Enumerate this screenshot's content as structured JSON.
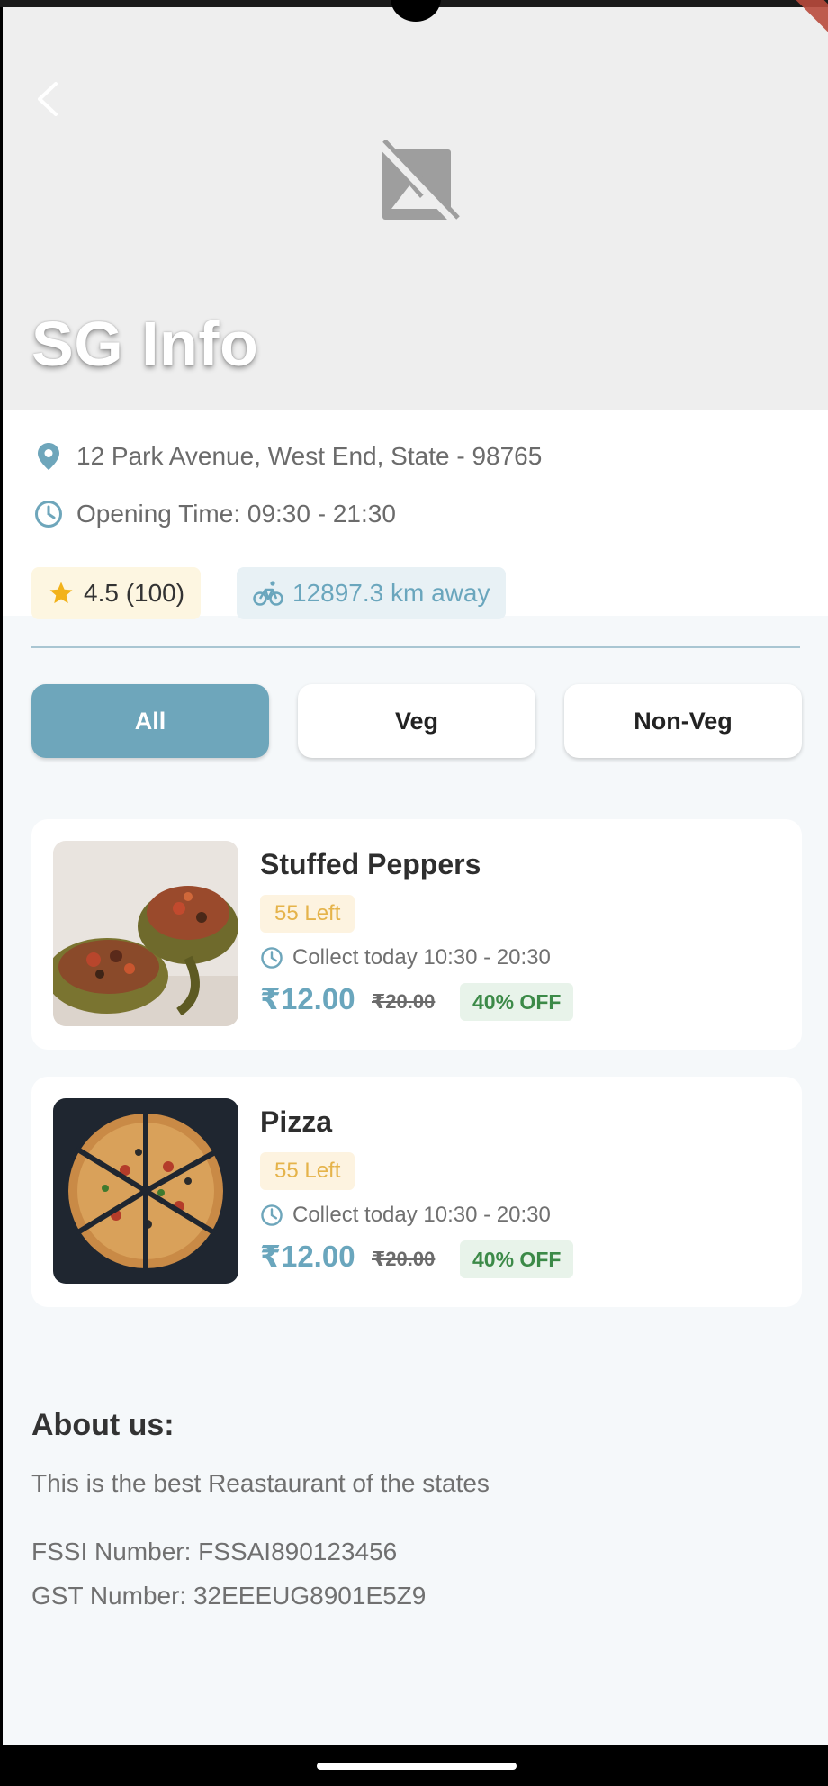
{
  "hero": {
    "title": "SG Info"
  },
  "info": {
    "address": "12 Park Avenue, West End, State - 98765",
    "opening_time": "Opening Time: 09:30 - 21:30",
    "rating": "4.5 (100)",
    "distance": "12897.3 km away"
  },
  "filters": {
    "all": "All",
    "veg": "Veg",
    "nonveg": "Non-Veg",
    "selected": "All"
  },
  "items": [
    {
      "name": "Stuffed Peppers",
      "left": "55 Left",
      "collect": "Collect today 10:30 - 20:30",
      "price": "₹12.00",
      "old_price": "₹20.00",
      "discount": "40% OFF"
    },
    {
      "name": "Pizza",
      "left": "55 Left",
      "collect": "Collect today 10:30 - 20:30",
      "price": "₹12.00",
      "old_price": "₹20.00",
      "discount": "40% OFF"
    }
  ],
  "about": {
    "title": "About us:",
    "text": "This is the best Reastaurant of the states",
    "fssi": "FSSI Number: FSSAI890123456",
    "gst": "GST Number: 32EEEUG8901E5Z9"
  },
  "colors": {
    "accent": "#6ea6bb",
    "rating_bg": "#fdf6e1",
    "star": "#f2b21a",
    "stock_text": "#e5b34a",
    "discount_text": "#3c8a48"
  },
  "icons": {
    "back": "chevron-left-icon",
    "image_placeholder": "broken-image-icon",
    "location": "location-pin-icon",
    "clock": "clock-icon",
    "star": "star-icon",
    "bike": "bicycle-icon"
  }
}
